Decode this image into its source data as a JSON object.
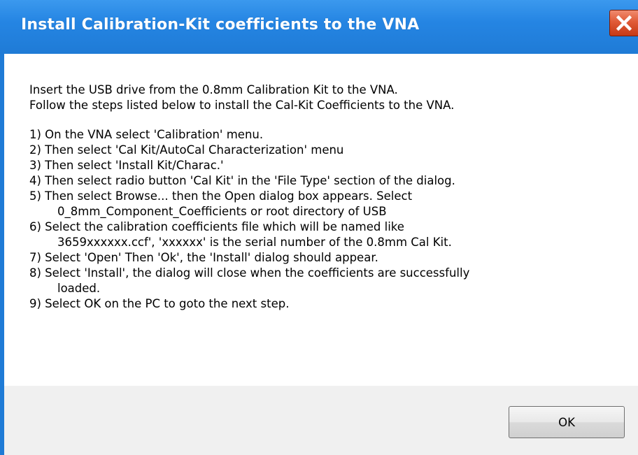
{
  "window": {
    "title": "Install Calibration-Kit coefficients to the VNA",
    "titlebar_color": "#1f7bd6",
    "close_button_color": "#e05a36"
  },
  "message": {
    "intro": [
      "Insert the USB drive from the 0.8mm Calibration Kit to the VNA.",
      "Follow the steps listed below to install the Cal-Kit Coefficients to the VNA."
    ],
    "steps": [
      {
        "text": "1)  On the VNA select 'Calibration' menu."
      },
      {
        "text": "2)  Then select 'Cal Kit/AutoCal Characterization' menu"
      },
      {
        "text": "3)  Then select 'Install Kit/Charac.'"
      },
      {
        "text": "4)  Then select radio button 'Cal Kit' in the 'File Type' section of the dialog."
      },
      {
        "text": "5)  Then select Browse... then the Open dialog box appears.  Select",
        "cont": "0_8mm_Component_Coefficients or root directory of USB"
      },
      {
        "text": "6)  Select the calibration coefficients file which will be named like",
        "cont": "3659xxxxxx.ccf', 'xxxxxx' is the serial number of the 0.8mm Cal Kit."
      },
      {
        "text": "7)  Select 'Open' Then 'Ok', the 'Install' dialog should appear."
      },
      {
        "text": "8)  Select 'Install', the dialog will close when the coefficients are successfully",
        "cont": "loaded."
      },
      {
        "text": "9) Select OK on the PC to goto the next step."
      }
    ]
  },
  "buttons": {
    "ok_label": "OK"
  }
}
